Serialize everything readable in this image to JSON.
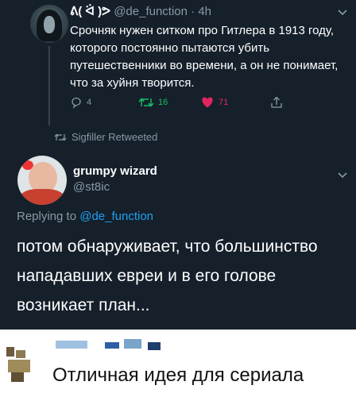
{
  "tweet": {
    "name": "ᕕ( ᐛ )ᕗ",
    "handle": "@de_function",
    "dot": "·",
    "time": "4h",
    "text": "Срочняк нужен ситком про Гитлера в 1913 году, которого постоянно пытаются убить путешественники во времени, а он не понимает, что за хуйня творится.",
    "replies": "4",
    "retweets": "16",
    "likes": "71"
  },
  "retweet_banner": {
    "label": "Sigfiller Retweeted"
  },
  "reply": {
    "name": "grumpy wizard",
    "handle": "@st8ic",
    "replying_to_prefix": "Replying to",
    "replying_to_mention": "@de_function",
    "text": "потом обнаруживает, что большинство нападавших евреи и в его голове возникает план..."
  },
  "caption": {
    "text": "Отличная идея для сериала"
  },
  "colors": {
    "background": "#15202b",
    "secondary_text": "#8899a6",
    "link": "#1da1f2",
    "retweet": "#17bf63",
    "like": "#e0245e",
    "caption_bg": "#ffffff"
  },
  "icons": [
    "chevron-down-icon",
    "reply-icon",
    "retweet-icon",
    "like-icon",
    "share-icon",
    "retweet-small-icon"
  ]
}
